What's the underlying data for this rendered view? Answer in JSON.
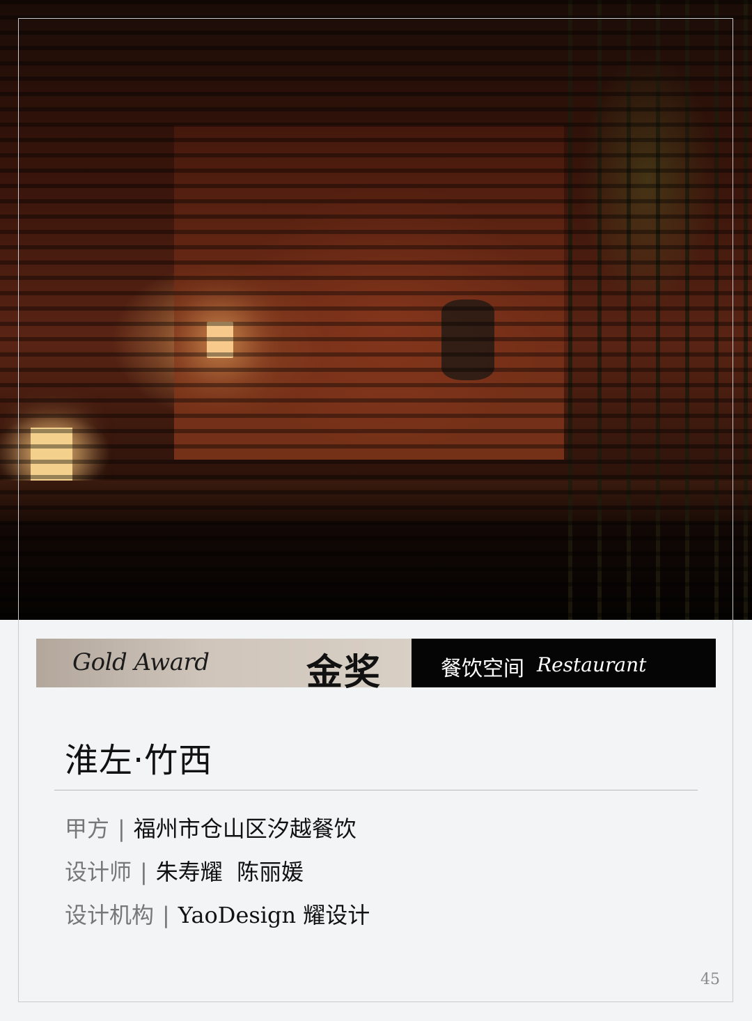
{
  "award": {
    "english": "Gold Award",
    "chinese": "金奖"
  },
  "category": {
    "chinese": "餐饮空间",
    "english": "Restaurant"
  },
  "project": {
    "title": "淮左·竹西"
  },
  "details": [
    {
      "label": "甲方",
      "separator": "|",
      "value": "福州市仓山区汐越餐饮"
    },
    {
      "label": "设计师",
      "separator": "|",
      "value": "朱寿耀  陈丽媛"
    },
    {
      "label": "设计机构",
      "separator": "|",
      "value": "YaoDesign 耀设计"
    }
  ],
  "page": {
    "number": "45"
  },
  "colors": {
    "award_gradient_start": "#b3a79c",
    "award_gradient_end": "#d8cfc5",
    "category_background": "#050505",
    "page_background": "#f3f4f6"
  }
}
